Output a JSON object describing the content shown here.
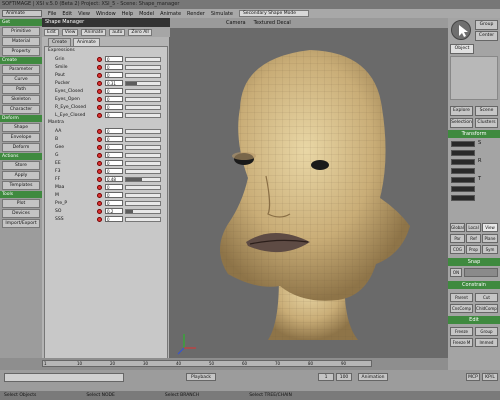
{
  "titlebar": {
    "title": "SOFTIMAGE | XSI v.5.0 (Beta 2) Project: XSI_5 - Scene: Shape_manager"
  },
  "menubar": {
    "mode": "Animate",
    "items": [
      "File",
      "Edit",
      "View",
      "Window",
      "Help",
      "Model",
      "Animate",
      "Render",
      "Simulate"
    ],
    "layout": "Secondary Shape Mode"
  },
  "left_panel": {
    "sections": [
      {
        "header": "Get",
        "buttons": [
          "Primitive",
          "Material",
          "Property"
        ]
      },
      {
        "header": "Create",
        "buttons": [
          "Parameter",
          "Curve",
          "Path",
          "Skeleton",
          "Character"
        ]
      },
      {
        "header": "Deform",
        "buttons": [
          "Shape",
          "Envelope",
          "Deform"
        ]
      },
      {
        "header": "Actions",
        "buttons": [
          "Store",
          "Apply",
          "Templates"
        ]
      },
      {
        "header": "Tools",
        "buttons": [
          "Plot",
          "Devices",
          "Import/Export"
        ]
      }
    ]
  },
  "shape_manager": {
    "title": "Shape Manager",
    "toolbar": [
      "Edit",
      "View",
      "Animate",
      "auto",
      "Zero All"
    ],
    "tabs": [
      "Create",
      "Animate"
    ],
    "groups": [
      {
        "name": "Expressions",
        "rows": [
          {
            "name": "Grin",
            "value": "0",
            "level": 0
          },
          {
            "name": "Smile",
            "value": "0",
            "level": 0
          },
          {
            "name": "Pout",
            "value": "0",
            "level": 0
          },
          {
            "name": "Pucker",
            "value": "0.31",
            "level": 0.31
          },
          {
            "name": "Eyes_Closed",
            "value": "0",
            "level": 0
          },
          {
            "name": "Eyes_Open",
            "value": "0",
            "level": 0
          },
          {
            "name": "R_Eye_Closed",
            "value": "0",
            "level": 0
          },
          {
            "name": "L_Eye_Closed",
            "value": "0",
            "level": 0
          }
        ]
      },
      {
        "name": "Mantra",
        "rows": [
          {
            "name": "AA",
            "value": "0",
            "level": 0
          },
          {
            "name": "B",
            "value": "0",
            "level": 0
          },
          {
            "name": "Gee",
            "value": "0",
            "level": 0
          },
          {
            "name": "G",
            "value": "0",
            "level": 0
          },
          {
            "name": "EE",
            "value": "0",
            "level": 0
          },
          {
            "name": "F3",
            "value": "0",
            "level": 0
          },
          {
            "name": "FF",
            "value": "0.48",
            "level": 0.48
          },
          {
            "name": "Maa",
            "value": "0",
            "level": 0
          },
          {
            "name": "M",
            "value": "0",
            "level": 0
          },
          {
            "name": "Pre_P",
            "value": "0",
            "level": 0
          },
          {
            "name": "SO",
            "value": "0.2",
            "level": 0.2
          },
          {
            "name": "SSS",
            "value": "0",
            "level": 0
          }
        ]
      }
    ]
  },
  "viewport": {
    "header": [
      "Camera",
      "Textured Decal"
    ]
  },
  "right_panel": {
    "select_buttons": [
      "Group",
      "Center",
      "Object"
    ],
    "explore": [
      "Explore",
      "Scene"
    ],
    "sel_buttons": [
      "Selection",
      "Clusters"
    ],
    "transform": "Transform",
    "xyz": [
      "S",
      "R",
      "T"
    ],
    "mode_row1": [
      "Global",
      "Local",
      "View"
    ],
    "mode_row2": [
      "Par",
      "Ref",
      "Plane"
    ],
    "mode_row3": [
      "COG",
      "Prop",
      "Sym"
    ],
    "snap": "Snap",
    "snap_state": "ON",
    "constrain": "Constrain",
    "constrain_buttons": [
      "Parent",
      "Cut",
      "CnsComp",
      "ChldComp"
    ],
    "edit": "Edit",
    "edit_buttons": [
      "Freeze",
      "Group",
      "Freeze M",
      "Immed"
    ]
  },
  "timeline": {
    "labels": [
      "1",
      "10",
      "20",
      "30",
      "40",
      "50",
      "60",
      "70",
      "80",
      "90"
    ]
  },
  "bottom": {
    "playback": "Playback",
    "frame": "1",
    "end": "100",
    "animation": "Animation",
    "mcp": "MCP",
    "kp": "KP/L"
  },
  "status": [
    "Select Objects",
    "Select NODE",
    "Select BRANCH",
    "Select TREE/CHAIN"
  ]
}
